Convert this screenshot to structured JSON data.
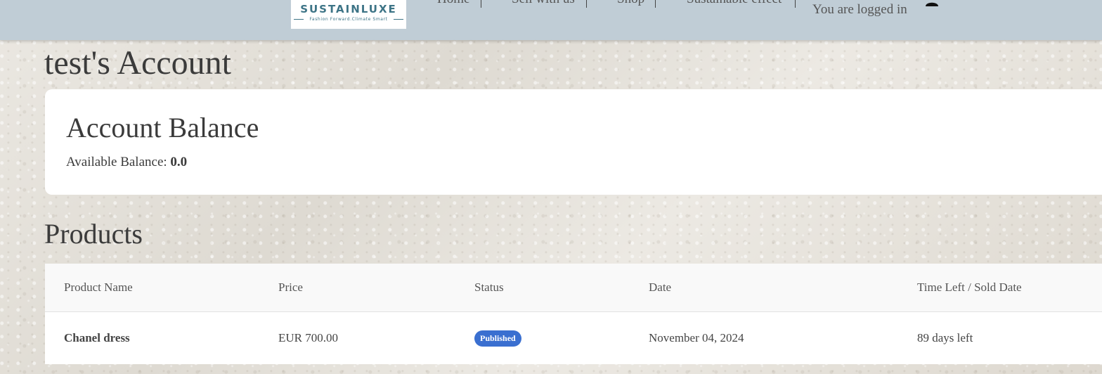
{
  "header": {
    "logo": {
      "name": "SUSTAINLUXE",
      "tagline": "Fashion Forward.Climate Smart"
    },
    "nav": [
      "Home",
      "Sell with us",
      "Shop",
      "Sustainable effect"
    ],
    "login_status": "You are logged in",
    "icons": {
      "user": "user-icon"
    }
  },
  "page": {
    "title": "test's Account"
  },
  "balance": {
    "title": "Account Balance",
    "label": "Available Balance:",
    "value": "0.0"
  },
  "products": {
    "heading": "Products",
    "columns": [
      "Product Name",
      "Price",
      "Status",
      "Date",
      "Time Left / Sold Date"
    ],
    "rows": [
      {
        "name": "Chanel dress",
        "price": "EUR 700.00",
        "status": "Published",
        "date": "November 04, 2024",
        "time_left": "89 days left"
      }
    ]
  },
  "colors": {
    "header_bg": "#c0cdd6",
    "brand": "#3d7486",
    "status_published": "#3a6fd0",
    "card_bg": "#ffffff"
  }
}
